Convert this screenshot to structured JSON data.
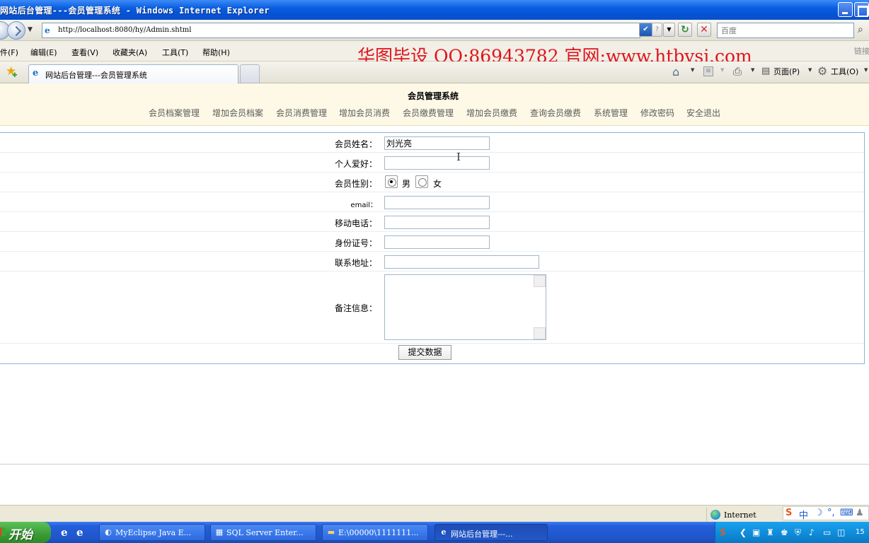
{
  "window": {
    "title": "网站后台管理---会员管理系统 - Windows Internet Explorer"
  },
  "address": {
    "url": "http://localhost:8080/hy/Admin.shtml",
    "search_placeholder": "百度"
  },
  "menu": {
    "items": [
      "件(F)",
      "编辑(E)",
      "查看(V)",
      "收藏夹(A)",
      "工具(T)",
      "帮助(H)"
    ]
  },
  "watermark": "华图毕设 QQ:86943782 官网:www.htbysj.com",
  "corner_text": "链接",
  "tabs": {
    "active_label": "网站后台管理---会员管理系统"
  },
  "commandbar": {
    "page_label": "页面(P)",
    "tools_label": "工具(O)"
  },
  "page": {
    "site_title": "会员管理系统",
    "nav": [
      "会员档案管理",
      "增加会员档案",
      "会员消费管理",
      "增加会员消费",
      "会员缴费管理",
      "增加会员缴费",
      "查询会员缴费",
      "系统管理",
      "修改密码",
      "安全退出"
    ]
  },
  "form": {
    "name_label": "会员姓名：",
    "name_value": "刘光亮",
    "hobby_label": "个人爱好：",
    "hobby_value": "",
    "gender_label": "会员性别：",
    "gender_options": [
      "男",
      "女"
    ],
    "gender_selected": "男",
    "email_label": "email：",
    "email_value": "",
    "mobile_label": "移动电话：",
    "mobile_value": "",
    "idcard_label": "身份证号：",
    "idcard_value": "",
    "address_label": "联系地址：",
    "address_value": "",
    "remark_label": "备注信息：",
    "remark_value": "",
    "submit_label": "提交数据"
  },
  "status": {
    "zone": "Internet",
    "ime_mode": "中"
  },
  "taskbar": {
    "start_label": "开始",
    "tasks": [
      "MyEclipse Java E...",
      "SQL Server Enter...",
      "E:\\00000\\1111111...",
      "网站后台管理---..."
    ],
    "clock": "15"
  }
}
